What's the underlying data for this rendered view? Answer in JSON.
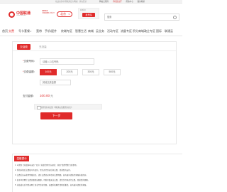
{
  "topbar": {
    "center_text": "欢迎来到中国联通官方网站！请先登录",
    "links": [
      "网站无障碍",
      "手机营业厅",
      "帮助中心",
      "我的联通"
    ]
  },
  "header": {
    "logo_name": "中国联通",
    "logo_sub": "China unicom",
    "brand_b": "10010",
    "brand_b_sub": "中国联通网上营业厅",
    "city": "北京",
    "ad_top": "联通首页",
    "ad_tag": "换号码",
    "search_placeholder": "搜索"
  },
  "nav": {
    "items": [
      "首页",
      "交费",
      "号卡套餐",
      "宽带",
      "手机/配件",
      "终端专区",
      "智慧生活",
      "商城",
      "云业务",
      "活动专区",
      "流量专区",
      "积分商城",
      "政企专区",
      "国际",
      "联通云"
    ]
  },
  "panel": {
    "tab_active": "交话费",
    "tab_inactive": "充流量",
    "phone_label": "交费号码：",
    "phone_placeholder": "请输入11位号码",
    "amount_label": "交费金额：",
    "amounts": [
      "100元",
      "200元",
      "300元",
      "500元"
    ],
    "custom_placeholder": "其他交费金额",
    "pay_label": "支付金额：",
    "pay_value": "100.00",
    "pay_unit": "元",
    "agree_text": "我同意并接受《联通充值服务协议》",
    "next_button": "下一步"
  },
  "notes": {
    "title": "温馨提示",
    "lines": [
      "1. ★优惠【充值满2元返】\"官方\" 充值优惠\"官方通告：获取\"话费代缴\"注意事项。",
      "2. 系统升级后交费账号有变化，需先进行登录后再交费，感谢您的支持。",
      "3. 交费后如未收到到账短信，请在交费记录中查询交费明细，如有疑问请拨打客服热线咨询。",
      "4. 由于本月累计交费金额超出限额，可能导致无法交费，请您次月再进行交费，感谢您的理解。",
      "5. 充值成功后可登录网上营业厅查询余额，如遇系统繁忙请稍后重试，如有疑问请联系客服。"
    ]
  }
}
